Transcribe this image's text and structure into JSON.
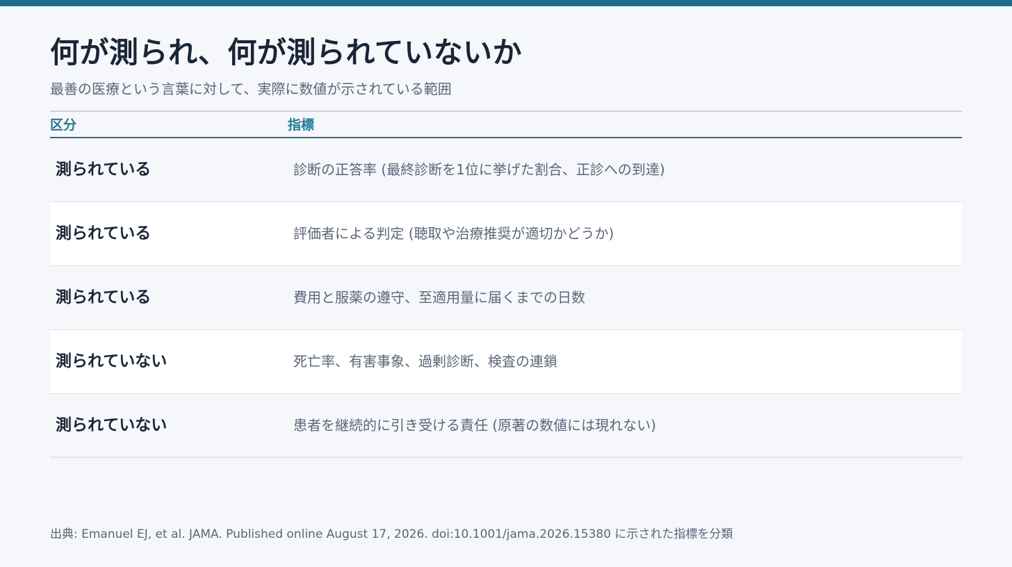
{
  "title": "何が測られ、何が測られていないか",
  "subtitle": "最善の医療という言葉に対して、実際に数値が示されている範囲",
  "table": {
    "headers": {
      "category": "区分",
      "indicator": "指標"
    },
    "rows": [
      {
        "category": "測られている",
        "indicator": "診断の正答率 (最終診断を1位に挙げた割合、正診への到達)"
      },
      {
        "category": "測られている",
        "indicator": "評価者による判定 (聴取や治療推奨が適切かどうか)"
      },
      {
        "category": "測られている",
        "indicator": "費用と服薬の遵守、至適用量に届くまでの日数"
      },
      {
        "category": "測られていない",
        "indicator": "死亡率、有害事象、過剰診断、検査の連鎖"
      },
      {
        "category": "測られていない",
        "indicator": "患者を継続的に引き受ける責任 (原著の数値には現れない)"
      }
    ]
  },
  "source": "出典: Emanuel EJ, et al. JAMA. Published online August 17, 2026. doi:10.1001/jama.2026.15380 に示された指標を分類",
  "colors": {
    "accent": "#1f6f89",
    "header_text": "#1f7a92",
    "background": "#f5f7fb",
    "title": "#1a2536",
    "body_text": "#5b6678"
  }
}
